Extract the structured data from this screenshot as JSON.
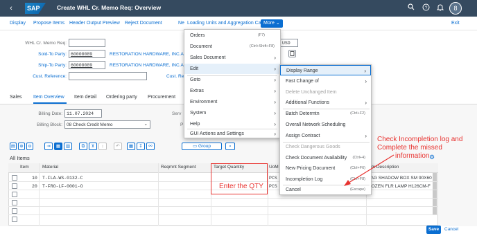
{
  "shell": {
    "back_icon": "‹",
    "logo": "SAP",
    "title": "Create WHL Cr. Memo Req: Overview",
    "avatar": "8"
  },
  "toolbar": {
    "display": "Display",
    "propose_items": "Propose Items",
    "header_output_preview": "Header Output Preview",
    "reject_document": "Reject Document",
    "net_fragment": "Ne",
    "loading_units": "Loading Units and Aggregation Categories",
    "more": "More",
    "exit": "Exit"
  },
  "header": {
    "memo_req_label": "WHL Cr. Memo Req:",
    "memo_req_value": "",
    "sold_to_label": "Sold-To Party:",
    "sold_to_value": "60000089",
    "sold_to_name": "RESTORATION HARDWARE, INC.AL",
    "ship_to_label": "Ship-To Party:",
    "ship_to_value": "60000089",
    "ship_to_name": "RESTORATION HARDWARE, INC.AL",
    "cust_ref_label": "Cust. Reference:",
    "cust_ref_value": "",
    "cust_re_fragment": "Cust. Re",
    "currency": "USD"
  },
  "tabs": [
    "Sales",
    "Item Overview",
    "Item detail",
    "Ordering party",
    "Procurement"
  ],
  "items_form": {
    "billing_date_label": "Billing Date:",
    "billing_date_value": "11.07.2024",
    "billing_block_label": "Billing Block:",
    "billing_block_value": "08 Check Credit Memo",
    "serv_fragment": "Serv",
    "p_fragment": "P",
    "group_label": "Group"
  },
  "table": {
    "title": "All Items",
    "columns": [
      "Item",
      "Material",
      "Reqmnt Segment",
      "Target Quantity",
      "UoM",
      "em Description"
    ],
    "rows": [
      {
        "item": "10",
        "material": "T-FLA-WS-0132-C",
        "uom": "PCS",
        "desc": "LAG SHADOW BOX SM 90X60"
      },
      {
        "item": "20",
        "material": "T-FRO-LF-0001-O",
        "uom": "PCS",
        "desc": "ROZEN FLR LAMP H126CM-F"
      }
    ]
  },
  "menu1": [
    {
      "label": "Orders",
      "shortcut": "(F7)",
      "arrow": ""
    },
    {
      "label": "Document",
      "shortcut": "(Ctrl+Shift+F8)",
      "arrow": ""
    },
    {
      "label": "Sales Document",
      "shortcut": "",
      "arrow": "›"
    },
    {
      "label": "Edit",
      "shortcut": "",
      "arrow": "›"
    },
    {
      "label": "Goto",
      "shortcut": "",
      "arrow": "›"
    },
    {
      "label": "Extras",
      "shortcut": "",
      "arrow": "›"
    },
    {
      "label": "Environment",
      "shortcut": "",
      "arrow": "›"
    },
    {
      "label": "System",
      "shortcut": "",
      "arrow": "›"
    },
    {
      "label": "Help",
      "shortcut": "",
      "arrow": "›"
    },
    {
      "label": "GUI Actions and Settings",
      "shortcut": "",
      "arrow": "›"
    }
  ],
  "menu2": [
    {
      "label": "Display Range",
      "shortcut": "",
      "arrow": "›"
    },
    {
      "label": "Fast Change of",
      "shortcut": "",
      "arrow": "›"
    },
    {
      "label": "Delete Unchanged Item",
      "shortcut": "",
      "arrow": ""
    },
    {
      "label": "Additional Functions",
      "shortcut": "",
      "arrow": "›"
    },
    {
      "label": "Batch Determtn",
      "shortcut": "(Ctrl+F2)",
      "arrow": ""
    },
    {
      "label": "Overall Network Scheduling",
      "shortcut": "",
      "arrow": ""
    },
    {
      "label": "Assign Contract",
      "shortcut": "",
      "arrow": "›"
    },
    {
      "label": "Check Dangerous Goods",
      "shortcut": "",
      "arrow": ""
    },
    {
      "label": "Check Document Availability",
      "shortcut": "(Ctrl+4)",
      "arrow": ""
    },
    {
      "label": "New Pricing Document",
      "shortcut": "(Ctrl+F6)",
      "arrow": ""
    },
    {
      "label": "Incompletion Log",
      "shortcut": "(Ctrl+F8)",
      "arrow": ""
    },
    {
      "label": "Cancel",
      "shortcut": "(Escape)",
      "arrow": ""
    }
  ],
  "annotations": {
    "qty_note": "Enter the QTY",
    "incompletion_note_1": "Check Incompletion log and",
    "incompletion_note_2": "Complete the missed",
    "incompletion_note_3": "information"
  },
  "footer": {
    "save": "Save",
    "cancel": "Cancel"
  },
  "colors": {
    "shell": "#354a5f",
    "accent": "#0a6ed1",
    "annotation_red": "#e8322f"
  }
}
